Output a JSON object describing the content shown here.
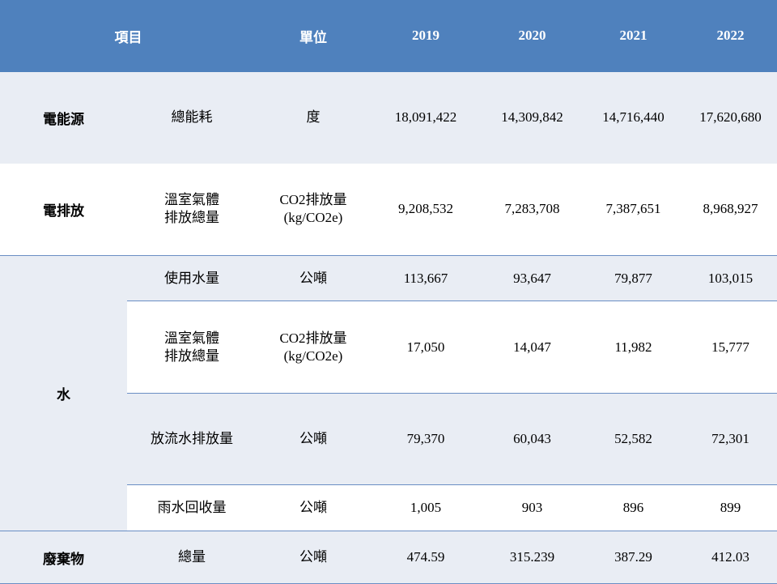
{
  "header": {
    "item": "項目",
    "unit": "單位",
    "years": [
      "2019",
      "2020",
      "2021",
      "2022"
    ]
  },
  "rows": [
    {
      "category": "電能源",
      "item": [
        "總能耗"
      ],
      "unit": [
        "度"
      ],
      "values": [
        "18,091,422",
        "14,309,842",
        "14,716,440",
        "17,620,680"
      ]
    },
    {
      "category": "電排放",
      "item": [
        "溫室氣體",
        "排放總量"
      ],
      "unit": [
        "CO2排放量",
        "(kg/CO2e)"
      ],
      "values": [
        "9,208,532",
        "7,283,708",
        "7,387,651",
        "8,968,927"
      ]
    },
    {
      "category": "水",
      "item": [
        "使用水量"
      ],
      "unit": [
        "公噸"
      ],
      "values": [
        "113,667",
        "93,647",
        "79,877",
        "103,015"
      ]
    },
    {
      "category": "",
      "item": [
        "溫室氣體",
        "排放總量"
      ],
      "unit": [
        "CO2排放量",
        "(kg/CO2e)"
      ],
      "values": [
        "17,050",
        "14,047",
        "11,982",
        "15,777"
      ]
    },
    {
      "category": "",
      "item": [
        "放流水排放量"
      ],
      "unit": [
        "公噸"
      ],
      "values": [
        "79,370",
        "60,043",
        "52,582",
        "72,301"
      ]
    },
    {
      "category": "",
      "item": [
        "雨水回收量"
      ],
      "unit": [
        "公噸"
      ],
      "values": [
        "1,005",
        "903",
        "896",
        "899"
      ]
    },
    {
      "category": "廢棄物",
      "item": [
        "總量"
      ],
      "unit": [
        "公噸"
      ],
      "values": [
        "474.59",
        "315.239",
        "387.29",
        "412.03"
      ]
    }
  ],
  "colors": {
    "header_bg": "#4f81bd",
    "header_text": "#ffffff",
    "row_shade": "#e9edf4",
    "row_white": "#ffffff",
    "border": "#6a8ec4"
  }
}
